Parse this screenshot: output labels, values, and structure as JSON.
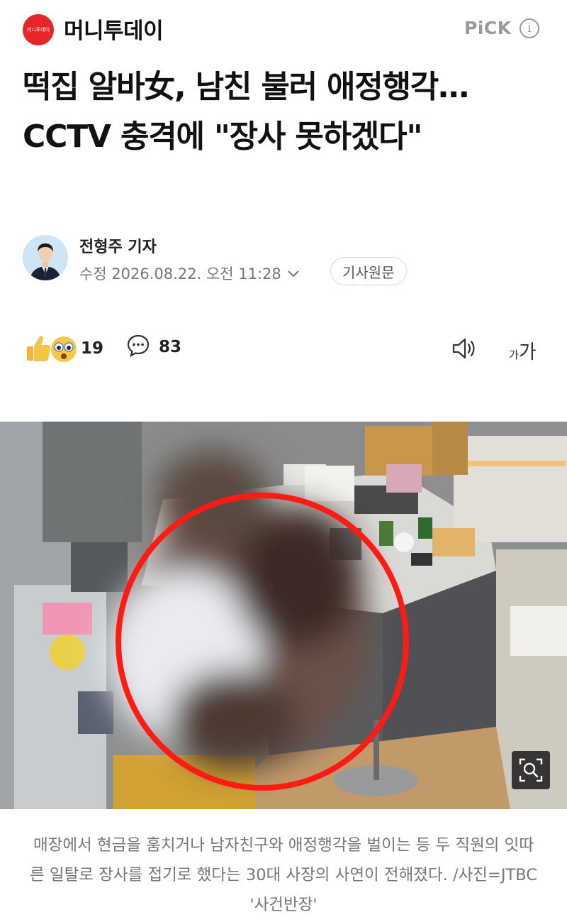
{
  "header": {
    "logo_text": "머니투데이",
    "brand": "머니투데이",
    "pick_label": "PiCK",
    "info_icon": "ⓘ"
  },
  "article": {
    "title": "떡집 알바女, 남친 불러 애정행각…CCTV 충격에 \"장사 못하겠다\"",
    "author": "전형주 기자",
    "modified": "수정 2026.08.22. 오전 11:28",
    "source_button": "기사원문"
  },
  "actions": {
    "reaction_count": "19",
    "comment_count": "83",
    "reaction_icons": [
      "thumbs-up-icon",
      "surprised-face-icon"
    ],
    "comment_icon": "speech-bubble-icon",
    "speaker_icon": "speaker-icon",
    "font_size_small": "가",
    "font_size_large": "가"
  },
  "photo": {
    "caption": "매장에서 현금을 훔치거나 남자친구와 애정행각을 벌이는 등 두 직원의 잇따른 일탈로 장사를 접기로 했다는 30대 사장의 사연이 전해졌다. /사진=JTBC '사건반장'",
    "zoom_icon": "zoom-magnifier-icon"
  },
  "colors": {
    "brand_red": "#e8262a",
    "highlight_circle": "#ff1a14",
    "muted_text": "#777777"
  }
}
